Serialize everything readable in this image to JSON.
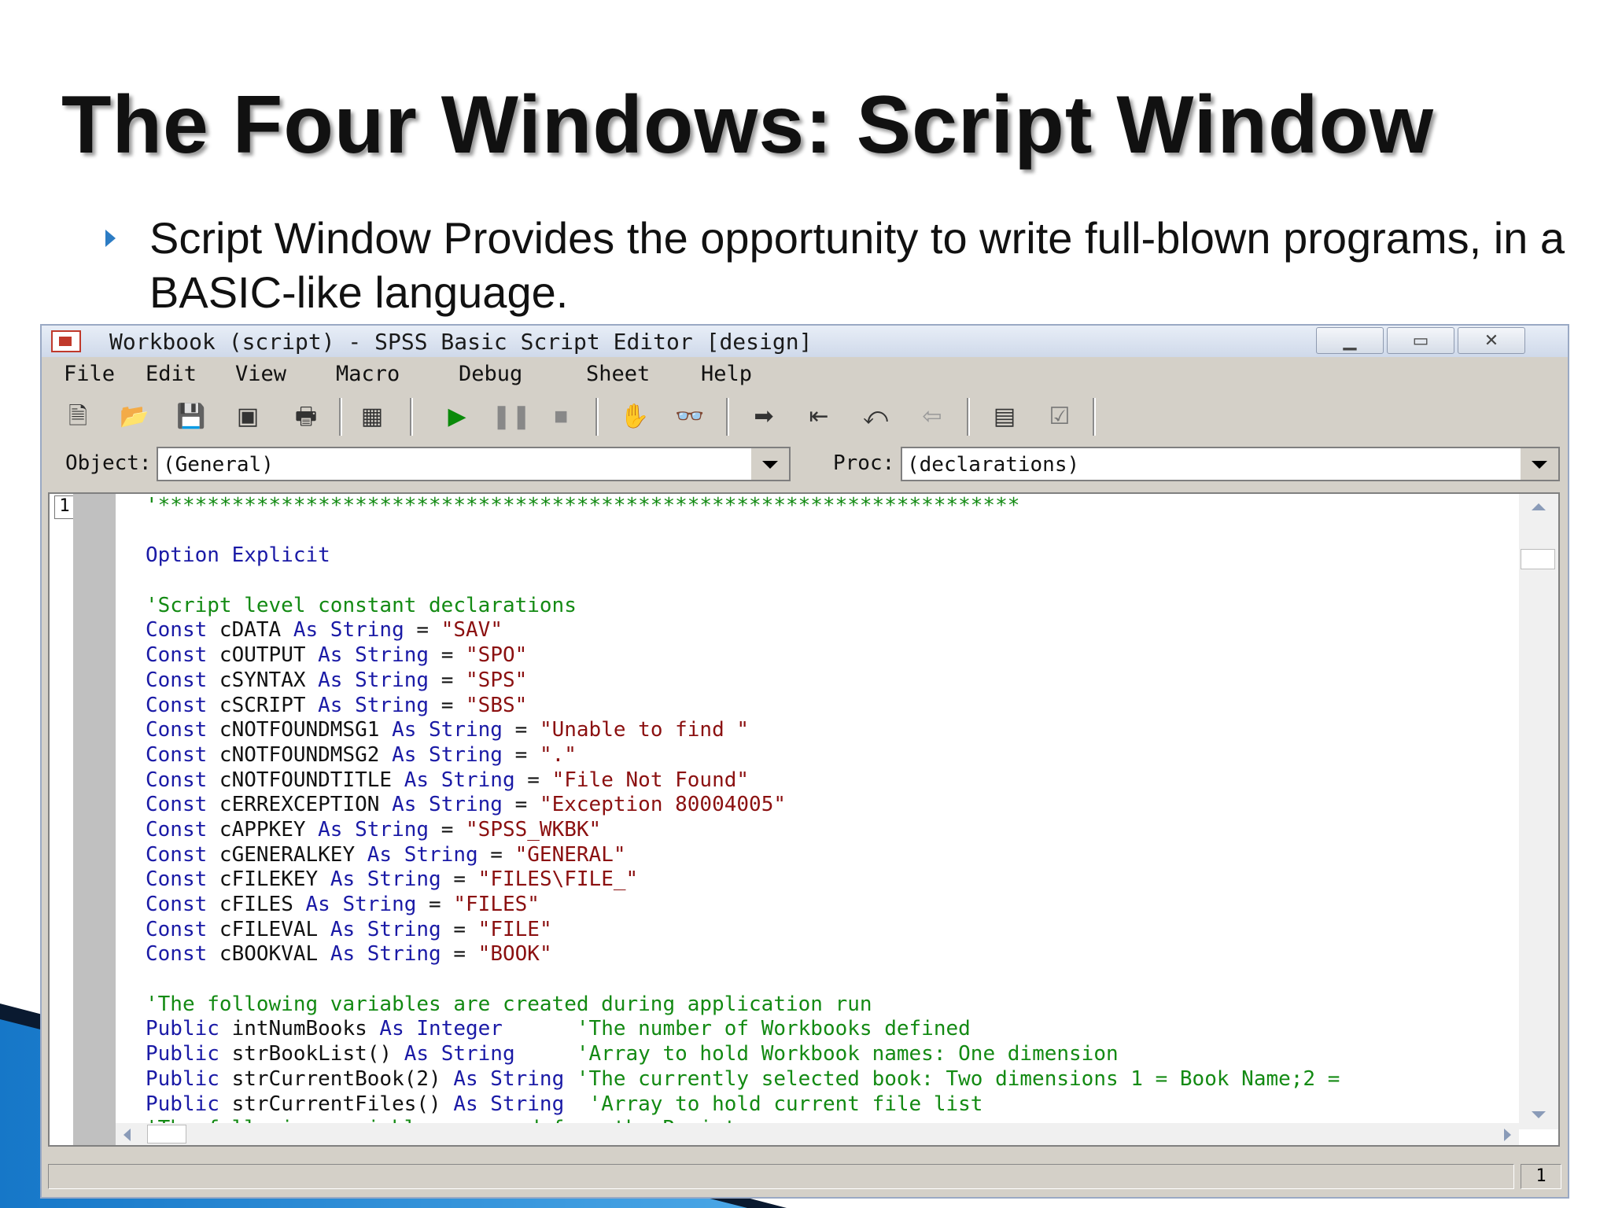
{
  "slide": {
    "title": "The Four Windows: Script Window",
    "bullet": "Script Window Provides the opportunity to write full-blown programs, in a BASIC-like language."
  },
  "window": {
    "title": "Workbook (script) - SPSS Basic Script Editor [design]",
    "menu": [
      "File",
      "Edit",
      "View",
      "Macro",
      "Debug",
      "Sheet",
      "Help"
    ],
    "toolbar_icons": [
      "new-script-icon",
      "open-icon",
      "save-icon",
      "save-all-icon",
      "print-icon",
      "dialog-editor-icon",
      "run-icon",
      "pause-icon",
      "stop-icon",
      "hand-icon",
      "watch-icon",
      "step-icon",
      "step-into-icon",
      "step-over-icon",
      "step-out-icon",
      "object-browser-icon",
      "properties-icon"
    ],
    "object_label": "Object:",
    "object_value": "(General)",
    "proc_label": "Proc:",
    "proc_value": "(declarations)",
    "line_number": "1",
    "status_line": "1"
  },
  "code_lines": [
    [
      {
        "t": "'**********************************************************************",
        "c": "cm"
      }
    ],
    [],
    [
      {
        "t": "Option Explicit",
        "c": "kw"
      }
    ],
    [],
    [
      {
        "t": "'Script level constant declarations",
        "c": "cm"
      }
    ],
    [
      {
        "t": "Const ",
        "c": "kw"
      },
      {
        "t": "cDATA ",
        "c": "id"
      },
      {
        "t": "As String",
        "c": "kw"
      },
      {
        "t": " = ",
        "c": "id"
      },
      {
        "t": "\"SAV\"",
        "c": "str"
      }
    ],
    [
      {
        "t": "Const ",
        "c": "kw"
      },
      {
        "t": "cOUTPUT ",
        "c": "id"
      },
      {
        "t": "As String",
        "c": "kw"
      },
      {
        "t": " = ",
        "c": "id"
      },
      {
        "t": "\"SPO\"",
        "c": "str"
      }
    ],
    [
      {
        "t": "Const ",
        "c": "kw"
      },
      {
        "t": "cSYNTAX ",
        "c": "id"
      },
      {
        "t": "As String",
        "c": "kw"
      },
      {
        "t": " = ",
        "c": "id"
      },
      {
        "t": "\"SPS\"",
        "c": "str"
      }
    ],
    [
      {
        "t": "Const ",
        "c": "kw"
      },
      {
        "t": "cSCRIPT ",
        "c": "id"
      },
      {
        "t": "As String",
        "c": "kw"
      },
      {
        "t": " = ",
        "c": "id"
      },
      {
        "t": "\"SBS\"",
        "c": "str"
      }
    ],
    [
      {
        "t": "Const ",
        "c": "kw"
      },
      {
        "t": "cNOTFOUNDMSG1 ",
        "c": "id"
      },
      {
        "t": "As String",
        "c": "kw"
      },
      {
        "t": " = ",
        "c": "id"
      },
      {
        "t": "\"Unable to find \"",
        "c": "str"
      }
    ],
    [
      {
        "t": "Const ",
        "c": "kw"
      },
      {
        "t": "cNOTFOUNDMSG2 ",
        "c": "id"
      },
      {
        "t": "As String",
        "c": "kw"
      },
      {
        "t": " = ",
        "c": "id"
      },
      {
        "t": "\".\"",
        "c": "str"
      }
    ],
    [
      {
        "t": "Const ",
        "c": "kw"
      },
      {
        "t": "cNOTFOUNDTITLE ",
        "c": "id"
      },
      {
        "t": "As String",
        "c": "kw"
      },
      {
        "t": " = ",
        "c": "id"
      },
      {
        "t": "\"File Not Found\"",
        "c": "str"
      }
    ],
    [
      {
        "t": "Const ",
        "c": "kw"
      },
      {
        "t": "cERREXCEPTION ",
        "c": "id"
      },
      {
        "t": "As String",
        "c": "kw"
      },
      {
        "t": " = ",
        "c": "id"
      },
      {
        "t": "\"Exception 80004005\"",
        "c": "str"
      }
    ],
    [
      {
        "t": "Const ",
        "c": "kw"
      },
      {
        "t": "cAPPKEY ",
        "c": "id"
      },
      {
        "t": "As String",
        "c": "kw"
      },
      {
        "t": " = ",
        "c": "id"
      },
      {
        "t": "\"SPSS_WKBK\"",
        "c": "str"
      }
    ],
    [
      {
        "t": "Const ",
        "c": "kw"
      },
      {
        "t": "cGENERALKEY ",
        "c": "id"
      },
      {
        "t": "As String",
        "c": "kw"
      },
      {
        "t": " = ",
        "c": "id"
      },
      {
        "t": "\"GENERAL\"",
        "c": "str"
      }
    ],
    [
      {
        "t": "Const ",
        "c": "kw"
      },
      {
        "t": "cFILEKEY ",
        "c": "id"
      },
      {
        "t": "As String",
        "c": "kw"
      },
      {
        "t": " = ",
        "c": "id"
      },
      {
        "t": "\"FILES\\FILE_\"",
        "c": "str"
      }
    ],
    [
      {
        "t": "Const ",
        "c": "kw"
      },
      {
        "t": "cFILES ",
        "c": "id"
      },
      {
        "t": "As String",
        "c": "kw"
      },
      {
        "t": " = ",
        "c": "id"
      },
      {
        "t": "\"FILES\"",
        "c": "str"
      }
    ],
    [
      {
        "t": "Const ",
        "c": "kw"
      },
      {
        "t": "cFILEVAL ",
        "c": "id"
      },
      {
        "t": "As String",
        "c": "kw"
      },
      {
        "t": " = ",
        "c": "id"
      },
      {
        "t": "\"FILE\"",
        "c": "str"
      }
    ],
    [
      {
        "t": "Const ",
        "c": "kw"
      },
      {
        "t": "cBOOKVAL ",
        "c": "id"
      },
      {
        "t": "As String",
        "c": "kw"
      },
      {
        "t": " = ",
        "c": "id"
      },
      {
        "t": "\"BOOK\"",
        "c": "str"
      }
    ],
    [],
    [
      {
        "t": "'The following variables are created during application run",
        "c": "cm"
      }
    ],
    [
      {
        "t": "Public ",
        "c": "kw"
      },
      {
        "t": "intNumBooks ",
        "c": "id"
      },
      {
        "t": "As Integer",
        "c": "kw"
      },
      {
        "t": "      'The number of Workbooks defined",
        "c": "cm"
      }
    ],
    [
      {
        "t": "Public ",
        "c": "kw"
      },
      {
        "t": "strBookList() ",
        "c": "id"
      },
      {
        "t": "As String",
        "c": "kw"
      },
      {
        "t": "     'Array to hold Workbook names: One dimension",
        "c": "cm"
      }
    ],
    [
      {
        "t": "Public ",
        "c": "kw"
      },
      {
        "t": "strCurrentBook(2) ",
        "c": "id"
      },
      {
        "t": "As String",
        "c": "kw"
      },
      {
        "t": " 'The currently selected book: Two dimensions 1 = Book Name;2 =",
        "c": "cm"
      }
    ],
    [
      {
        "t": "Public ",
        "c": "kw"
      },
      {
        "t": "strCurrentFiles() ",
        "c": "id"
      },
      {
        "t": "As String",
        "c": "kw"
      },
      {
        "t": "  'Array to hold current file list",
        "c": "cm"
      }
    ],
    [
      {
        "t": "'The following variable are read from the Registry",
        "c": "cm"
      }
    ]
  ]
}
